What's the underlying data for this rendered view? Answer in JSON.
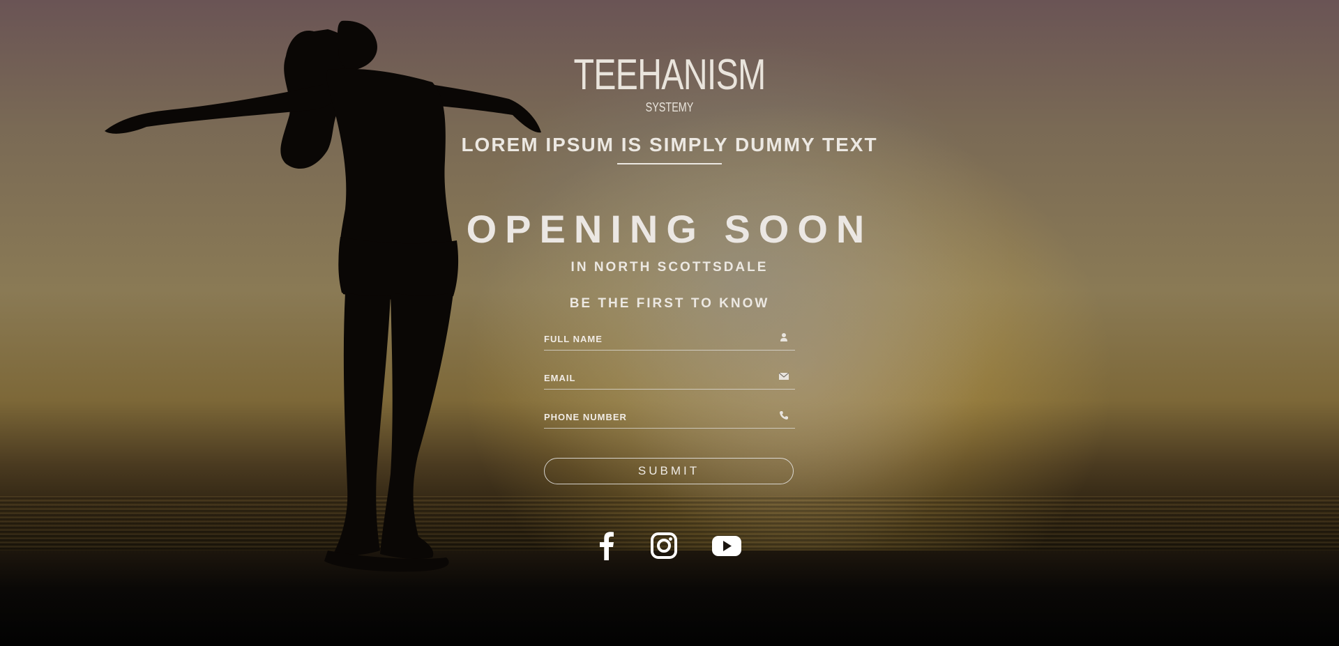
{
  "brand": {
    "name": "TEEHANISM",
    "subtitle": "SYSTEMY"
  },
  "tagline": "LOREM IPSUM IS SIMPLY DUMMY TEXT",
  "headline": "OPENING SOON",
  "location": "IN NORTH SCOTTSDALE",
  "signup": {
    "heading": "BE THE FIRST TO KNOW",
    "fields": [
      {
        "placeholder": "FULL NAME",
        "icon": "user-icon"
      },
      {
        "placeholder": "EMAIL",
        "icon": "envelope-icon"
      },
      {
        "placeholder": "PHONE NUMBER",
        "icon": "phone-icon"
      }
    ],
    "submit_label": "SUBMIT"
  },
  "social": [
    {
      "icon": "facebook-icon"
    },
    {
      "icon": "instagram-icon"
    },
    {
      "icon": "youtube-icon"
    }
  ],
  "colors": {
    "text": "#ECE8E2",
    "background_sky": "#7A6A55",
    "sun_glow": "#E6BE50",
    "ground": "#030303"
  }
}
